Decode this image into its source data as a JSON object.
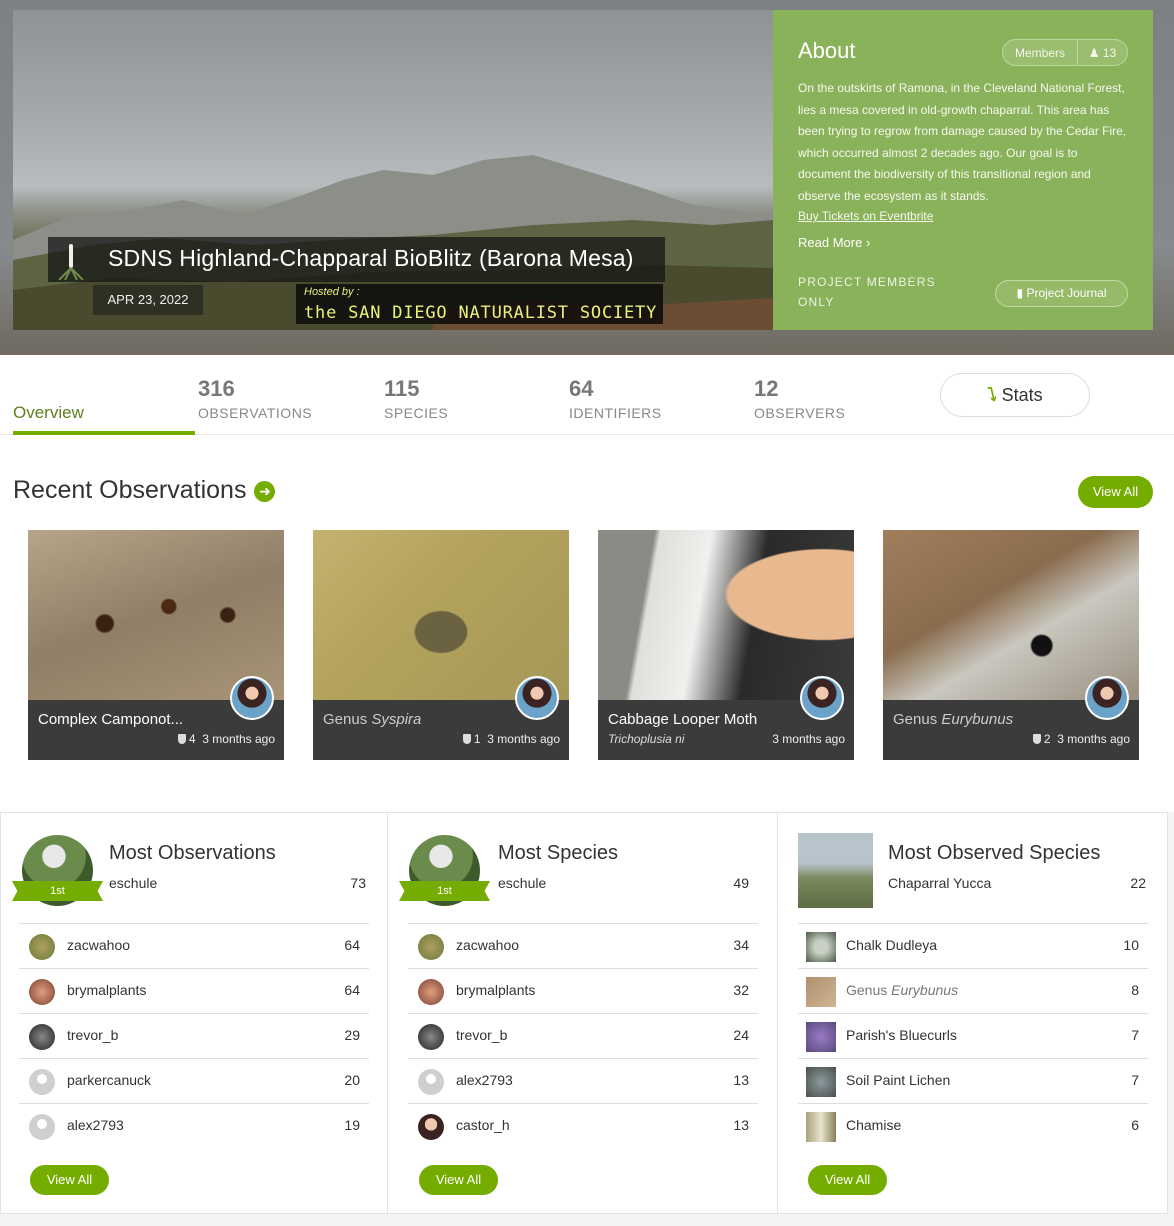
{
  "project": {
    "title": "SDNS Highland-Chapparal BioBlitz (Barona Mesa)",
    "date": "APR 23, 2022",
    "hosted_label": "Hosted by :",
    "hosted_name": "the SAN DIEGO NATURALIST SOCIETY"
  },
  "about": {
    "title": "About",
    "members_label": "Members",
    "members_count": "13",
    "description": "On the outskirts of Ramona, in the Cleveland National Forest, lies a mesa covered in old-growth chaparral. This area has been trying to regrow from damage caused by the Cedar Fire, which occurred almost 2 decades ago. Our goal is to document the biodiversity of this transitional region and observe the ecosystem as it stands.",
    "tickets_link": "Buy Tickets on Eventbrite",
    "read_more": "Read More",
    "members_only": "PROJECT MEMBERS ONLY",
    "journal_button": "Project Journal"
  },
  "tabs": {
    "overview": "Overview",
    "observations": {
      "count": "316",
      "label": "OBSERVATIONS"
    },
    "species": {
      "count": "115",
      "label": "SPECIES"
    },
    "identifiers": {
      "count": "64",
      "label": "IDENTIFIERS"
    },
    "observers": {
      "count": "12",
      "label": "OBSERVERS"
    },
    "stats": "Stats"
  },
  "recent": {
    "title": "Recent Observations",
    "view_all": "View All",
    "cards": [
      {
        "name": "Complex Camponot...",
        "ids": "4",
        "time": "3 months ago"
      },
      {
        "name_prefix": "Genus ",
        "name_italic": "Syspira",
        "ids": "1",
        "time": "3 months ago"
      },
      {
        "name": "Cabbage Looper Moth",
        "sci": "Trichoplusia ni",
        "time": "3 months ago"
      },
      {
        "name_prefix": "Genus ",
        "name_italic": "Eurybunus",
        "ids": "2",
        "time": "3 months ago"
      }
    ]
  },
  "leaderboards": {
    "most_observations": {
      "title": "Most Observations",
      "ribbon": "1st",
      "first": {
        "name": "eschule",
        "count": "73"
      },
      "rows": [
        {
          "name": "zacwahoo",
          "count": "64"
        },
        {
          "name": "brymalplants",
          "count": "64"
        },
        {
          "name": "trevor_b",
          "count": "29"
        },
        {
          "name": "parkercanuck",
          "count": "20"
        },
        {
          "name": "alex2793",
          "count": "19"
        }
      ],
      "view_all": "View All"
    },
    "most_species": {
      "title": "Most Species",
      "ribbon": "1st",
      "first": {
        "name": "eschule",
        "count": "49"
      },
      "rows": [
        {
          "name": "zacwahoo",
          "count": "34"
        },
        {
          "name": "brymalplants",
          "count": "32"
        },
        {
          "name": "trevor_b",
          "count": "24"
        },
        {
          "name": "alex2793",
          "count": "13"
        },
        {
          "name": "castor_h",
          "count": "13"
        }
      ],
      "view_all": "View All"
    },
    "most_observed_species": {
      "title": "Most Observed Species",
      "first": {
        "name": "Chaparral Yucca",
        "count": "22"
      },
      "rows": [
        {
          "name": "Chalk Dudleya",
          "count": "10"
        },
        {
          "name_prefix": "Genus ",
          "name_italic": "Eurybunus",
          "count": "8"
        },
        {
          "name": "Parish's Bluecurls",
          "count": "7"
        },
        {
          "name": "Soil Paint Lichen",
          "count": "7"
        },
        {
          "name": "Chamise",
          "count": "6"
        }
      ],
      "view_all": "View All"
    }
  }
}
